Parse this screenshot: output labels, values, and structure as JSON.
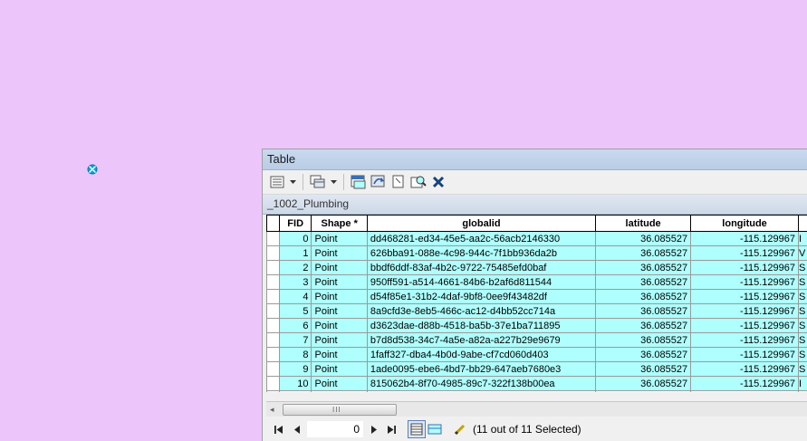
{
  "window": {
    "title": "Table"
  },
  "table_name": "_1002_Plumbing",
  "columns": [
    "FID",
    "Shape *",
    "globalid",
    "latitude",
    "longitude"
  ],
  "rows": [
    {
      "fid": "0",
      "shape": "Point",
      "globalid": "dd468281-ed34-45e5-aa2c-56acb2146330",
      "latitude": "36.085527",
      "longitude": "-115.129967",
      "extra": "I"
    },
    {
      "fid": "1",
      "shape": "Point",
      "globalid": "626bba91-088e-4c98-944c-7f1bb936da2b",
      "latitude": "36.085527",
      "longitude": "-115.129967",
      "extra": "V"
    },
    {
      "fid": "2",
      "shape": "Point",
      "globalid": "bbdf6ddf-83af-4b2c-9722-75485efd0baf",
      "latitude": "36.085527",
      "longitude": "-115.129967",
      "extra": "S"
    },
    {
      "fid": "3",
      "shape": "Point",
      "globalid": "950ff591-a514-4661-84b6-b2af6d811544",
      "latitude": "36.085527",
      "longitude": "-115.129967",
      "extra": "S"
    },
    {
      "fid": "4",
      "shape": "Point",
      "globalid": "d54f85e1-31b2-4daf-9bf8-0ee9f43482df",
      "latitude": "36.085527",
      "longitude": "-115.129967",
      "extra": "S"
    },
    {
      "fid": "5",
      "shape": "Point",
      "globalid": "8a9cfd3e-8eb5-466c-ac12-d4bb52cc714a",
      "latitude": "36.085527",
      "longitude": "-115.129967",
      "extra": "S"
    },
    {
      "fid": "6",
      "shape": "Point",
      "globalid": "d3623dae-d88b-4518-ba5b-37e1ba711895",
      "latitude": "36.085527",
      "longitude": "-115.129967",
      "extra": "S"
    },
    {
      "fid": "7",
      "shape": "Point",
      "globalid": "b7d8d538-34c7-4a5e-a82a-a227b29e9679",
      "latitude": "36.085527",
      "longitude": "-115.129967",
      "extra": "S"
    },
    {
      "fid": "8",
      "shape": "Point",
      "globalid": "1faff327-dba4-4b0d-9abe-cf7cd060d403",
      "latitude": "36.085527",
      "longitude": "-115.129967",
      "extra": "S"
    },
    {
      "fid": "9",
      "shape": "Point",
      "globalid": "1ade0095-ebe6-4bd7-bb29-647aeb7680e3",
      "latitude": "36.085527",
      "longitude": "-115.129967",
      "extra": "S"
    },
    {
      "fid": "10",
      "shape": "Point",
      "globalid": "815062b4-8f70-4985-89c7-322f138b00ea",
      "latitude": "36.085527",
      "longitude": "-115.129967",
      "extra": "I"
    }
  ],
  "navigation": {
    "record_number": "0",
    "selection_status": "(11 out of 11 Selected)"
  },
  "colors": {
    "map_background": "#ecc6fb",
    "selected_row": "#aefffd",
    "point_symbol": "#00a6d6"
  },
  "icons": [
    "table-options-icon",
    "related-tables-icon",
    "select-by-attributes-icon",
    "switch-selection-icon",
    "clear-selection-icon",
    "zoom-to-selected-icon",
    "delete-selected-icon",
    "first-record-icon",
    "previous-record-icon",
    "next-record-icon",
    "last-record-icon",
    "show-all-records-icon",
    "show-selected-records-icon",
    "edit-pencil-icon",
    "map-point-icon"
  ]
}
